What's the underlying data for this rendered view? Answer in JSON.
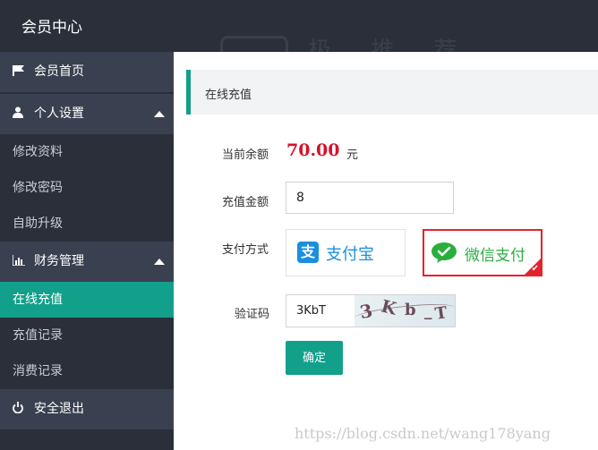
{
  "app": {
    "title": "会员中心",
    "watermark": "极 推 荐"
  },
  "sidebar": {
    "home": {
      "label": "会员首页",
      "icon": "flag-icon"
    },
    "groups": [
      {
        "label": "个人设置",
        "icon": "user-icon",
        "items": [
          "修改资料",
          "修改密码",
          "自助升级"
        ]
      },
      {
        "label": "财务管理",
        "icon": "bar-chart-icon",
        "items": [
          "在线充值",
          "充值记录",
          "消费记录"
        ],
        "active_item": "在线充值"
      }
    ],
    "logout": {
      "label": "安全退出",
      "icon": "power-icon"
    }
  },
  "panel": {
    "title": "在线充值"
  },
  "form": {
    "balance_label": "当前余额",
    "balance_value": "70.00",
    "balance_unit": "元",
    "amount_label": "充值金额",
    "amount_value": "8",
    "pay_label": "支付方式",
    "pay_options": [
      {
        "name": "支付宝",
        "selected": false
      },
      {
        "name": "微信支付",
        "selected": true
      }
    ],
    "captcha_label": "验证码",
    "captcha_value": "3KbT",
    "captcha_image_text": "3 K b _T",
    "submit_label": "确定"
  },
  "colors": {
    "accent": "#12a08b",
    "balance": "#d4142b",
    "alipay": "#1a8fe0",
    "wechat": "#2aae3e",
    "selected_border": "#e3232c"
  },
  "url_watermark": "https://blog.csdn.net/wang178yang"
}
